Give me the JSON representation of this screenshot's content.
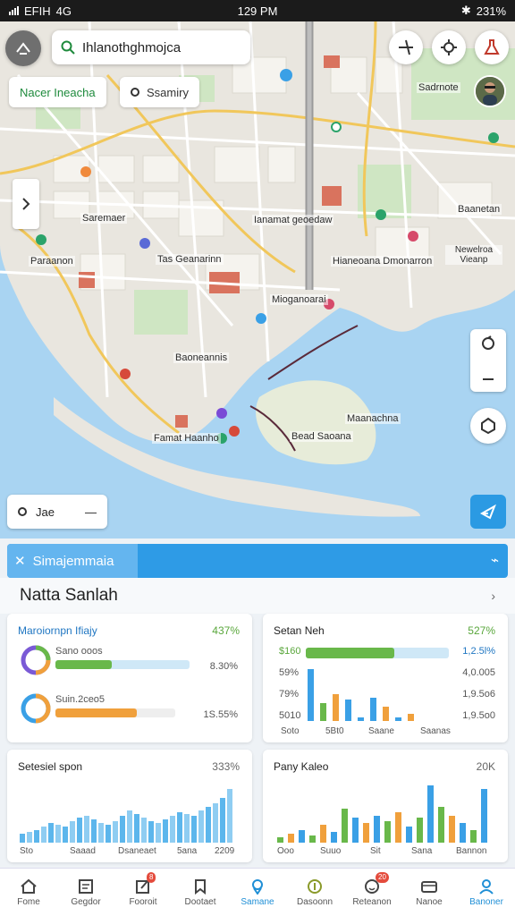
{
  "status_bar": {
    "carrier": "EFIH",
    "network": "4G",
    "time": "129 PM",
    "battery": "231%"
  },
  "map": {
    "search_text": "Ihlanothghmojca",
    "chip_green": "Nacer Ineacha",
    "chip_white": "Ssamiry",
    "labels": {
      "l1": "Saremaer",
      "l2": "Paraanon",
      "l3": "Tas Geanarinn",
      "l4": "Mioganoarai",
      "l5": "Ianamat geoedaw",
      "l6": "Hianeoana Dmonarron",
      "l7": "Newelroa Vieanp",
      "l8": "Baanetan",
      "l9": "Sadrnote",
      "l10": "Famat Haanho",
      "l11": "Baoneannis",
      "l12": "Maanachna",
      "l13": "Bead Saoana"
    },
    "scale_text": "Jae"
  },
  "sheet": {
    "tab_label": "Simajemmaia",
    "section_title": "Natta Sanlah",
    "card1": {
      "title": "Maroiornpn Ifiajy",
      "value": "437%",
      "row1_label": "Sano ooos",
      "row1_value": "8.30%",
      "row1_progress": 0.42,
      "row2_label": "Suin.2ceo5",
      "row2_value": "1S.55%",
      "row2_progress": 0.68
    },
    "card2": {
      "title": "Setan Neh",
      "value": "527%",
      "y_labels": [
        "$160",
        "59%",
        "79%",
        "5010"
      ],
      "right_labels": [
        "1,2.5l%",
        "4,0.005",
        "1,9.5o6",
        "1,9.5o0"
      ],
      "x_labels": [
        "Soto",
        "5Bt0",
        "Saane",
        "Saanas"
      ],
      "top_bar_progress": 0.62
    },
    "card3": {
      "title": "Setesiel spon",
      "value": "333%",
      "x_labels": [
        "Sto",
        "Saaad",
        "Dsaneaet",
        "5ana",
        "2209"
      ]
    },
    "card4": {
      "title": "Pany Kaleo",
      "value": "20K",
      "x_labels": [
        "Ooo",
        "Suuo",
        "Sit",
        "Sana",
        "Bannon"
      ]
    }
  },
  "bottom_nav": {
    "items": [
      {
        "label": "Fome",
        "icon": "home-icon"
      },
      {
        "label": "Gegdor",
        "icon": "news-icon"
      },
      {
        "label": "Fooroit",
        "icon": "edit-icon",
        "badge": "8"
      },
      {
        "label": "Dootaet",
        "icon": "bookmark-icon"
      },
      {
        "label": "Samane",
        "icon": "map-pin-icon",
        "active": true
      },
      {
        "label": "Dasoonn",
        "icon": "coin-icon"
      },
      {
        "label": "Reteanon",
        "icon": "smile-icon",
        "badge": "20"
      },
      {
        "label": "Nanoe",
        "icon": "wallet-icon"
      },
      {
        "label": "Banoner",
        "icon": "profile-icon",
        "active": true
      }
    ]
  },
  "colors": {
    "accent": "#2e9be6",
    "green": "#69b84a",
    "orange": "#f0a03c",
    "water": "#a9d4f2"
  }
}
